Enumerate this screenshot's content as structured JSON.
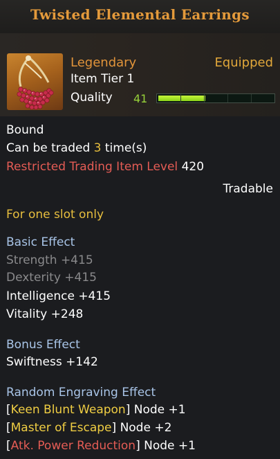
{
  "title": "Twisted Elemental Earrings",
  "header": {
    "rarity": "Legendary",
    "status": "Equipped",
    "tier": "Item Tier 1",
    "quality_label": "Quality",
    "quality_value": "41",
    "quality_fraction": 0.41
  },
  "trade": {
    "bound": "Bound",
    "traded_prefix": "Can be traded ",
    "traded_count": "3",
    "traded_suffix": " time(s)",
    "restricted_label": "Restricted Trading Item Level",
    "restricted_value": "420",
    "tradable": "Tradable"
  },
  "slot_note": "For one slot only",
  "basic_effect": {
    "heading": "Basic Effect",
    "stats": [
      {
        "label": "Strength +415",
        "active": false
      },
      {
        "label": "Dexterity +415",
        "active": false
      },
      {
        "label": "Intelligence +415",
        "active": true
      },
      {
        "label": "Vitality +248",
        "active": true
      }
    ]
  },
  "bonus_effect": {
    "heading": "Bonus Effect",
    "stat": "Swiftness +142"
  },
  "engraving": {
    "heading": "Random Engraving Effect",
    "items": [
      {
        "name": "Keen Blunt Weapon",
        "node": "Node +1",
        "color": "#f0ce43"
      },
      {
        "name": "Master of Escape",
        "node": "Node +2",
        "color": "#f0ce43"
      },
      {
        "name": "Atk. Power Reduction",
        "node": "Node +1",
        "color": "#e55c55"
      }
    ]
  },
  "colors": {
    "title": "#e49a3b",
    "legendary": "#e2943a",
    "quality_bar": "#a6e42a",
    "blue_heading": "#a9c5e8",
    "restriction": "#e55c55",
    "note": "#e7be3e"
  },
  "icons": {
    "item": "earring-icon"
  }
}
